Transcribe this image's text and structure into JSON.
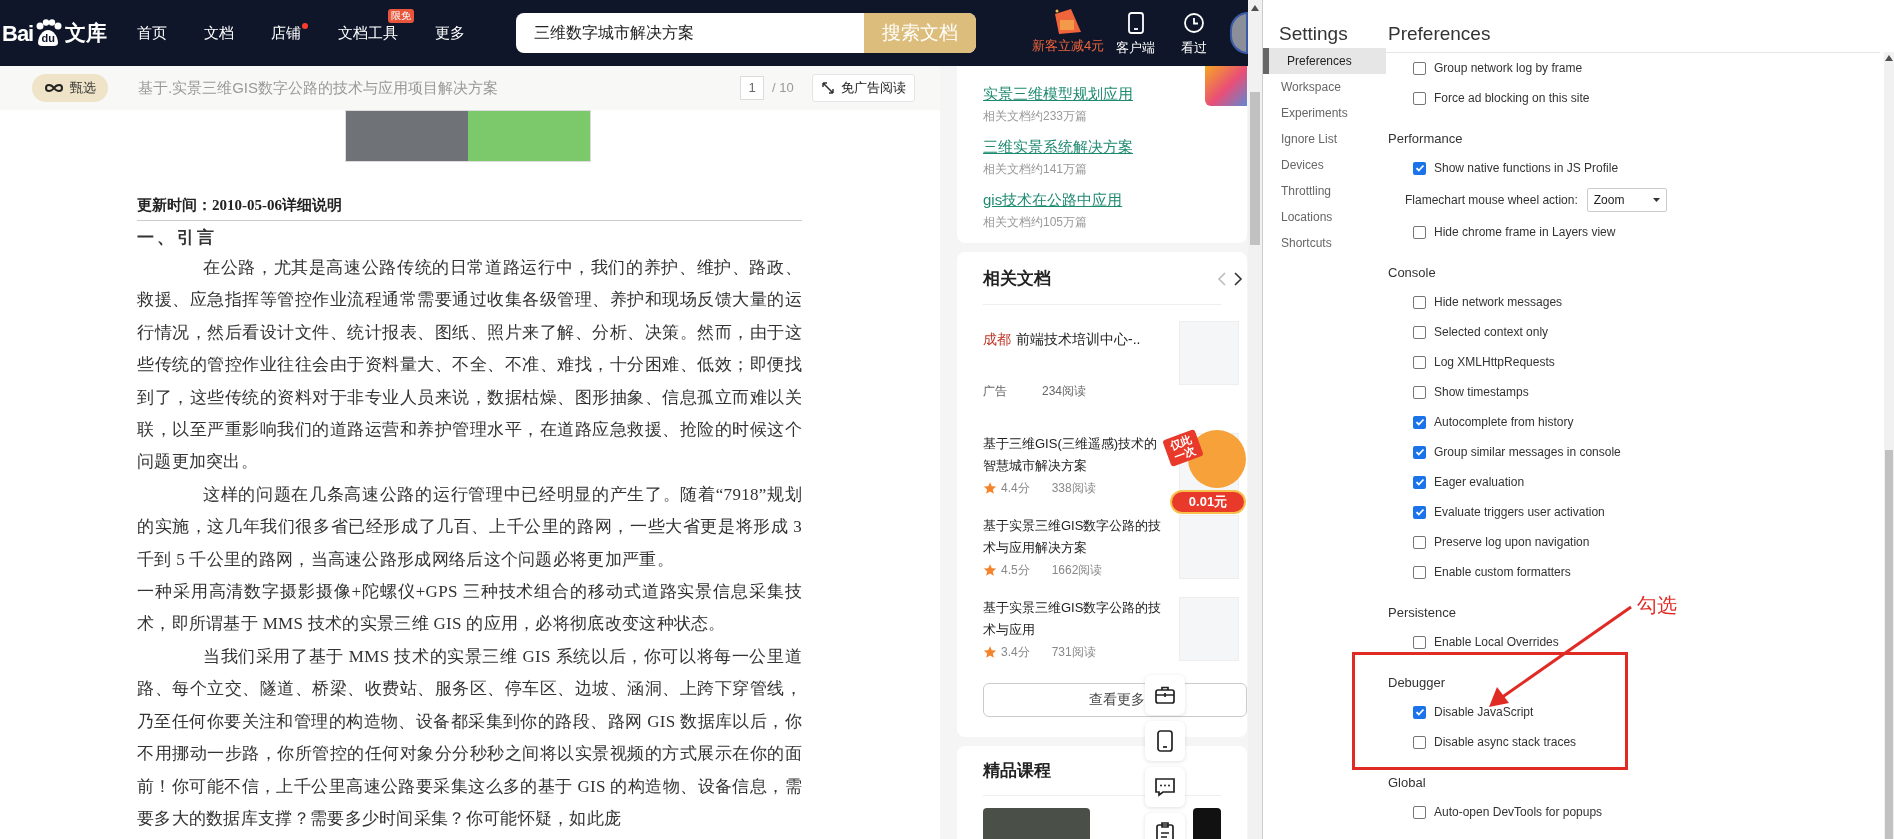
{
  "header": {
    "logo": {
      "text": "Bai",
      "mark": "du",
      "suffix": "文库"
    },
    "nav": [
      {
        "label": "首页",
        "dot": false
      },
      {
        "label": "文档",
        "dot": false
      },
      {
        "label": "店铺",
        "dot": true
      },
      {
        "label": "文档工具",
        "dot": false,
        "badge": "限免"
      },
      {
        "label": "更多",
        "dot": false
      }
    ],
    "search": {
      "value": "三维数字城市解决方案",
      "button": "搜索文档"
    },
    "promo": "新客立减4元",
    "actions": [
      {
        "kind": "phone",
        "label": "客户端"
      },
      {
        "kind": "clock",
        "label": "看过"
      }
    ]
  },
  "doc_bar": {
    "tag": "甄选",
    "title": "基于.实景三维GIS数字公路的技术与应用项目解决方案",
    "page": "1",
    "total": "/ 10",
    "ad_free": "免广告阅读"
  },
  "document": {
    "update": "更新时间：2010-05-06详细说明",
    "heading": "一、引言",
    "paragraphs": [
      {
        "indent": true,
        "text": "在公路，尤其是高速公路传统的日常道路运行中，我们的养护、维护、路政、救援、应急指挥等管控作业流程通常需要通过收集各级管理、养护和现场反馈大量的运行情况，然后看设计文件、统计报表、图纸、照片来了解、分析、决策。然而，由于这些传统的管控作业往往会由于资料量大、不全、不准、难找，十分困难、低效；即便找到了，这些传统的资料对于非专业人员来说，数据枯燥、图形抽象、信息孤立而难以关联，以至严重影响我们的道路运营和养护管理水平，在道路应急救援、抢险的时候这个问题更加突出。"
      },
      {
        "indent": true,
        "text": "这样的问题在几条高速公路的运行管理中已经明显的产生了。随着“7918”规划的实施，这几年我们很多省已经形成了几百、上千公里的路网，一些大省更是将形成 3 千到 5 千公里的路网，当高速公路形成网络后这个问题必将更加严重。"
      },
      {
        "indent": false,
        "text": "一种采用高清数字摄影摄像+陀螺仪+GPS 三种技术组合的移动式道路实景信息采集技术，即所谓基于 MMS 技术的实景三维 GIS 的应用，必将彻底改变这种状态。"
      },
      {
        "indent": true,
        "text": "当我们采用了基于 MMS 技术的实景三维 GIS 系统以后，你可以将每一公里道路、每个立交、隧道、桥梁、收费站、服务区、停车区、边坡、涵洞、上跨下穿管线，乃至任何你要关注和管理的构造物、设备都采集到你的路段、路网 GIS 数据库以后，你不用挪动一步路，你所管控的任何对象分分秒秒之间将以实景视频的方式展示在你的面前！你可能不信，上千公里高速公路要采集这么多的基于 GIS 的构造物、设备信息，需要多大的数据库支撑？需要多少时间采集？你可能怀疑，如此庞"
      }
    ]
  },
  "related_searches": [
    {
      "title": "实景三维模型规划应用",
      "count": "相关文档约233万篇"
    },
    {
      "title": "三维实景系统解决方案",
      "count": "相关文档约141万篇"
    },
    {
      "title": "gis技术在公路中应用",
      "count": "相关文档约105万篇"
    }
  ],
  "related_docs": {
    "title": "相关文档",
    "items": [
      {
        "kind": "ad",
        "city": "成都",
        "title": "前端技术培训中心-..",
        "tag": "广告",
        "reads": "234阅读"
      },
      {
        "kind": "doc",
        "title": "基于三维GIS(三维遥感)技术的智慧城市解决方案",
        "score": "4.4分",
        "reads": "338阅读"
      },
      {
        "kind": "doc",
        "title": "基于实景三维GIS数字公路的技术与应用解决方案",
        "score": "4.5分",
        "reads": "1662阅读"
      },
      {
        "kind": "doc",
        "title": "基于实景三维GIS数字公路的技术与应用",
        "score": "3.4分",
        "reads": "731阅读"
      }
    ],
    "more": "查看更多"
  },
  "sticker": {
    "top": "仅此一次",
    "price": "0.01元"
  },
  "courses": {
    "title": "精品课程"
  },
  "devtools": {
    "title": "Settings",
    "heading": "Preferences",
    "nav": [
      {
        "label": "Preferences",
        "selected": true
      },
      {
        "label": "Workspace",
        "selected": false
      },
      {
        "label": "Experiments",
        "selected": false
      },
      {
        "label": "Ignore List",
        "selected": false
      },
      {
        "label": "Devices",
        "selected": false
      },
      {
        "label": "Throttling",
        "selected": false
      },
      {
        "label": "Locations",
        "selected": false
      },
      {
        "label": "Shortcuts",
        "selected": false
      }
    ],
    "sections": [
      {
        "items": [
          {
            "kind": "checkbox",
            "label": "Group network log by frame",
            "checked": false
          },
          {
            "kind": "checkbox",
            "label": "Force ad blocking on this site",
            "checked": false
          }
        ]
      },
      {
        "title": "Performance",
        "items": [
          {
            "kind": "checkbox",
            "label": "Show native functions in JS Profile",
            "checked": true
          },
          {
            "kind": "select",
            "label": "Flamechart mouse wheel action:",
            "value": "Zoom"
          },
          {
            "kind": "checkbox",
            "label": "Hide chrome frame in Layers view",
            "checked": false
          }
        ]
      },
      {
        "title": "Console",
        "items": [
          {
            "kind": "checkbox",
            "label": "Hide network messages",
            "checked": false
          },
          {
            "kind": "checkbox",
            "label": "Selected context only",
            "checked": false
          },
          {
            "kind": "checkbox",
            "label": "Log XMLHttpRequests",
            "checked": false
          },
          {
            "kind": "checkbox",
            "label": "Show timestamps",
            "checked": false
          },
          {
            "kind": "checkbox",
            "label": "Autocomplete from history",
            "checked": true
          },
          {
            "kind": "checkbox",
            "label": "Group similar messages in console",
            "checked": true
          },
          {
            "kind": "checkbox",
            "label": "Eager evaluation",
            "checked": true
          },
          {
            "kind": "checkbox",
            "label": "Evaluate triggers user activation",
            "checked": true
          },
          {
            "kind": "checkbox",
            "label": "Preserve log upon navigation",
            "checked": false
          },
          {
            "kind": "checkbox",
            "label": "Enable custom formatters",
            "checked": false
          }
        ]
      },
      {
        "title": "Persistence",
        "items": [
          {
            "kind": "checkbox",
            "label": "Enable Local Overrides",
            "checked": false
          }
        ]
      },
      {
        "title": "Debugger",
        "items": [
          {
            "kind": "checkbox",
            "label": "Disable JavaScript",
            "checked": true
          },
          {
            "kind": "checkbox",
            "label": "Disable async stack traces",
            "checked": false
          }
        ]
      },
      {
        "title": "Global",
        "items": [
          {
            "kind": "checkbox",
            "label": "Auto-open DevTools for popups",
            "checked": false
          }
        ]
      }
    ]
  },
  "annotation": {
    "label": "勾选"
  }
}
